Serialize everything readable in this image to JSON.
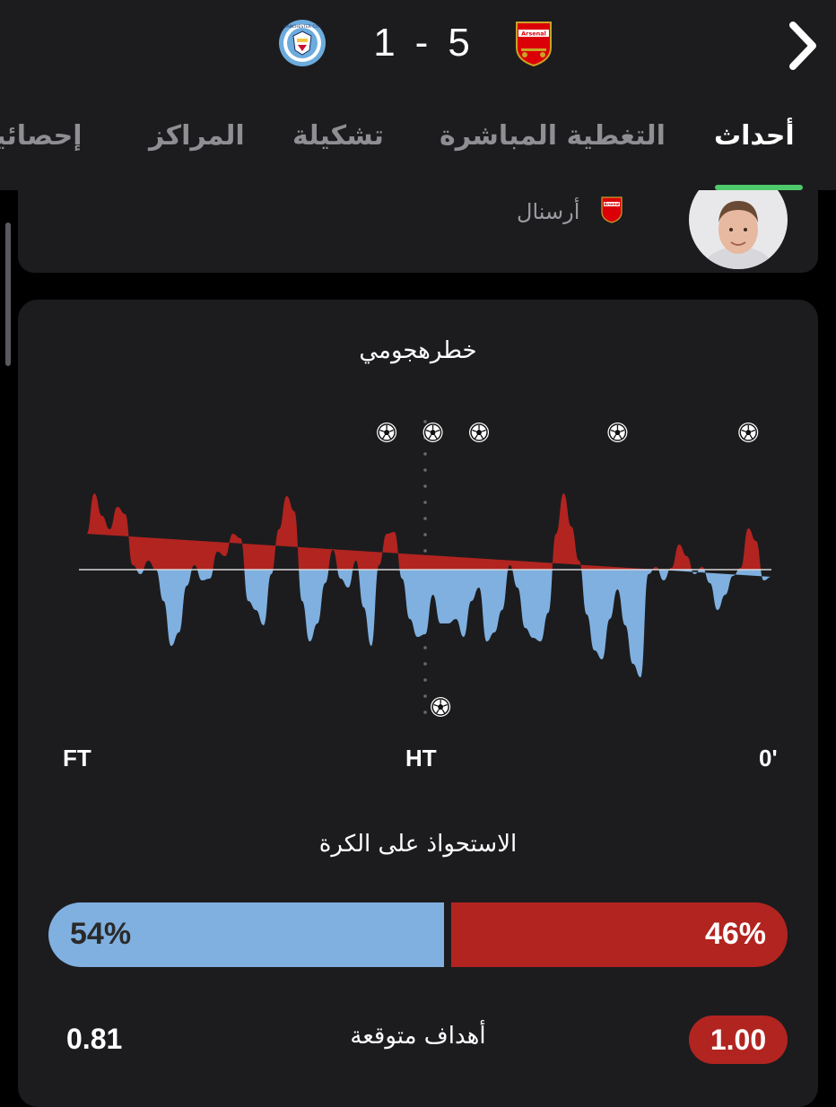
{
  "match": {
    "home_score": "1",
    "separator": "-",
    "away_score": "5",
    "home_team_crest": "manchester-city-crest",
    "away_team_crest": "arsenal-crest",
    "home_crest_text": "MANCHESTER CITY",
    "away_crest_text": "Arsenal"
  },
  "tabs": [
    {
      "label": "أحداث",
      "active": true
    },
    {
      "label": "التغطية المباشرة",
      "active": false
    },
    {
      "label": "تشكيلة",
      "active": false
    },
    {
      "label": "المراكز",
      "active": false
    },
    {
      "label": "إحصائيا",
      "active": false
    }
  ],
  "event_card": {
    "team_name": "أرسنال",
    "team_crest_text": "Arsenal"
  },
  "momentum": {
    "title": "خطرهجومي",
    "labels": {
      "full_time": "FT",
      "half_time": "HT",
      "start": "0'"
    },
    "colors": {
      "away": "#b22420",
      "home": "#7fb0e0"
    }
  },
  "chart_data": {
    "type": "area",
    "title": "خطرهجومي",
    "x_direction": "right-to-left",
    "xlim": [
      0,
      90
    ],
    "ylim": [
      -1,
      1
    ],
    "series": [],
    "x": [
      0,
      1,
      2,
      3,
      4,
      5,
      6,
      7,
      8,
      9,
      10,
      11,
      12,
      13,
      14,
      15,
      16,
      17,
      18,
      19,
      20,
      21,
      22,
      23,
      24,
      25,
      26,
      27,
      28,
      29,
      30,
      31,
      32,
      33,
      34,
      35,
      36,
      37,
      38,
      39,
      40,
      41,
      42,
      43,
      44,
      45,
      46,
      47,
      48,
      49,
      50,
      51,
      52,
      53,
      54,
      55,
      56,
      57,
      58,
      59,
      60,
      61,
      62,
      63,
      64,
      65,
      66,
      67,
      68,
      69,
      70,
      71,
      72,
      73,
      74,
      75,
      76,
      77,
      78,
      79,
      80,
      81,
      82,
      83,
      84,
      85,
      86,
      87,
      88,
      89,
      90
    ],
    "values": [
      -0.08,
      -0.12,
      0.32,
      0.46,
      0.02,
      -0.07,
      -0.28,
      -0.45,
      -0.15,
      0.03,
      -0.05,
      0.15,
      0.28,
      0.02,
      -0.12,
      0.03,
      -0.05,
      -1.2,
      -1.05,
      -0.62,
      -0.22,
      -0.55,
      -1.0,
      -0.9,
      -0.5,
      0.1,
      0.48,
      0.85,
      0.4,
      -0.48,
      -0.8,
      -0.76,
      -0.65,
      -0.2,
      0.05,
      -0.45,
      -0.7,
      -0.8,
      -0.2,
      -0.35,
      -0.75,
      -0.55,
      -0.6,
      -0.6,
      -0.28,
      -0.72,
      -0.75,
      -0.55,
      -0.1,
      0.42,
      0.4,
      0.05,
      -0.85,
      -0.42,
      0.1,
      -0.2,
      -0.1,
      0.22,
      -0.15,
      -0.6,
      -0.8,
      -0.35,
      0.65,
      0.82,
      0.45,
      -0.05,
      -0.62,
      -0.45,
      -0.35,
      0.35,
      0.4,
      0.15,
      0.2,
      -0.1,
      -0.12,
      0.05,
      -0.18,
      -0.7,
      -0.85,
      -0.35,
      0.0,
      0.1,
      -0.05,
      0.05,
      0.62,
      0.7,
      0.45,
      0.6,
      0.85,
      0.4
    ],
    "goals": {
      "away": [
        3,
        20,
        38,
        44,
        50
      ],
      "home": [
        43
      ]
    },
    "legend": "none"
  },
  "possession": {
    "title": "الاستحواذ على الكرة",
    "home_value": 54,
    "away_value": 46,
    "home_label": "54%",
    "away_label": "46%"
  },
  "xg": {
    "label": "أهداف متوقعة",
    "home_value": "0.81",
    "away_value": "1.00"
  }
}
